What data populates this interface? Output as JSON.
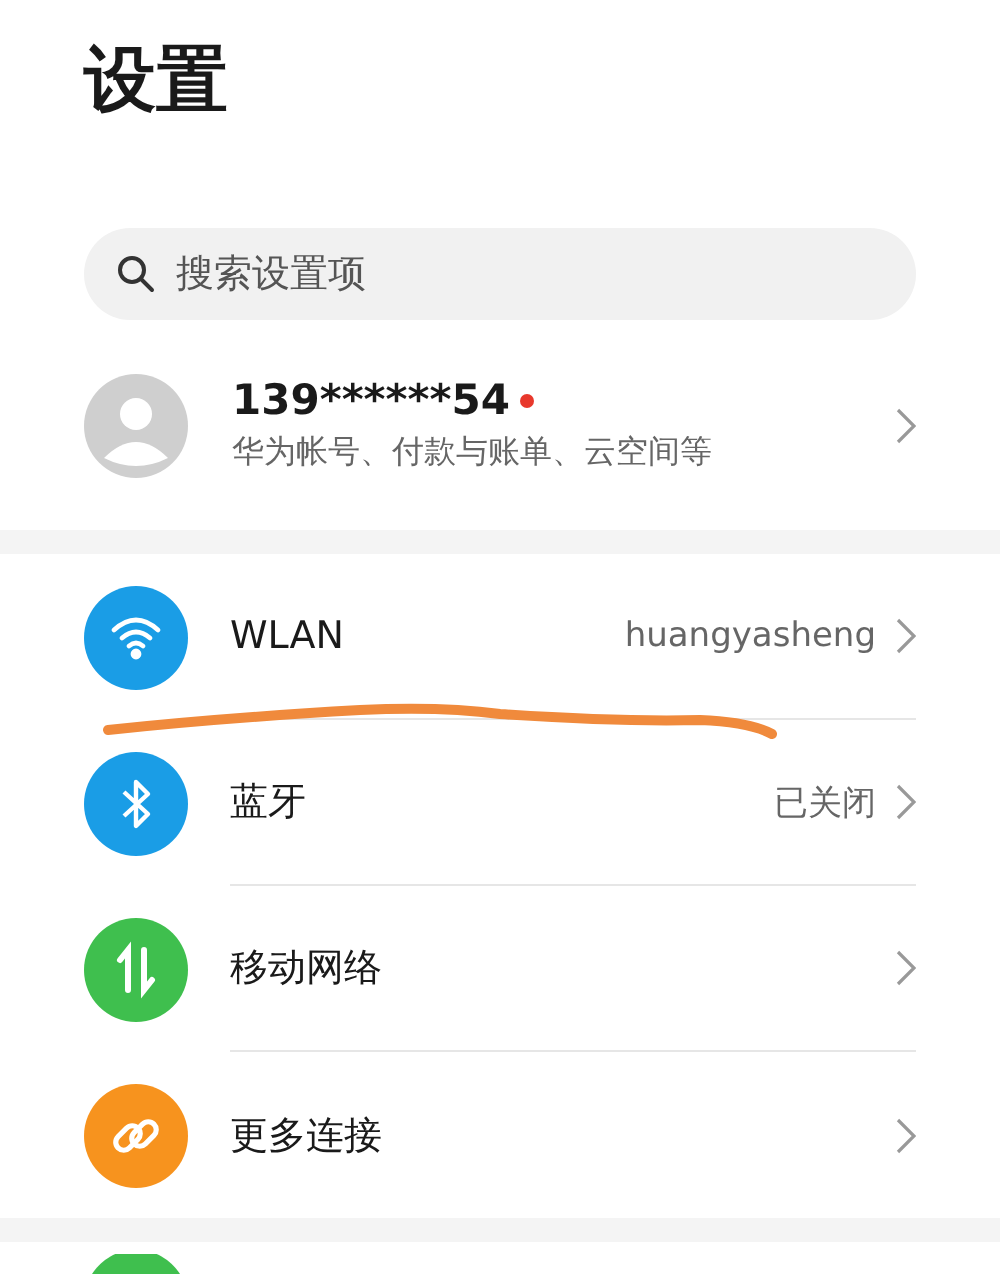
{
  "title": "设置",
  "search": {
    "placeholder": "搜索设置项"
  },
  "account": {
    "name": "139******54",
    "notification_dot": true,
    "subtitle": "华为帐号、付款与账单、云空间等"
  },
  "items": [
    {
      "label": "WLAN",
      "value": "huangyasheng",
      "color": "#1a9de6"
    },
    {
      "label": "蓝牙",
      "value": "已关闭",
      "color": "#1a9de6"
    },
    {
      "label": "移动网络",
      "color": "#3fbf4e"
    },
    {
      "label": "更多连接",
      "color": "#f7931e"
    }
  ],
  "next_item": {
    "color": "#3fbf4e"
  }
}
